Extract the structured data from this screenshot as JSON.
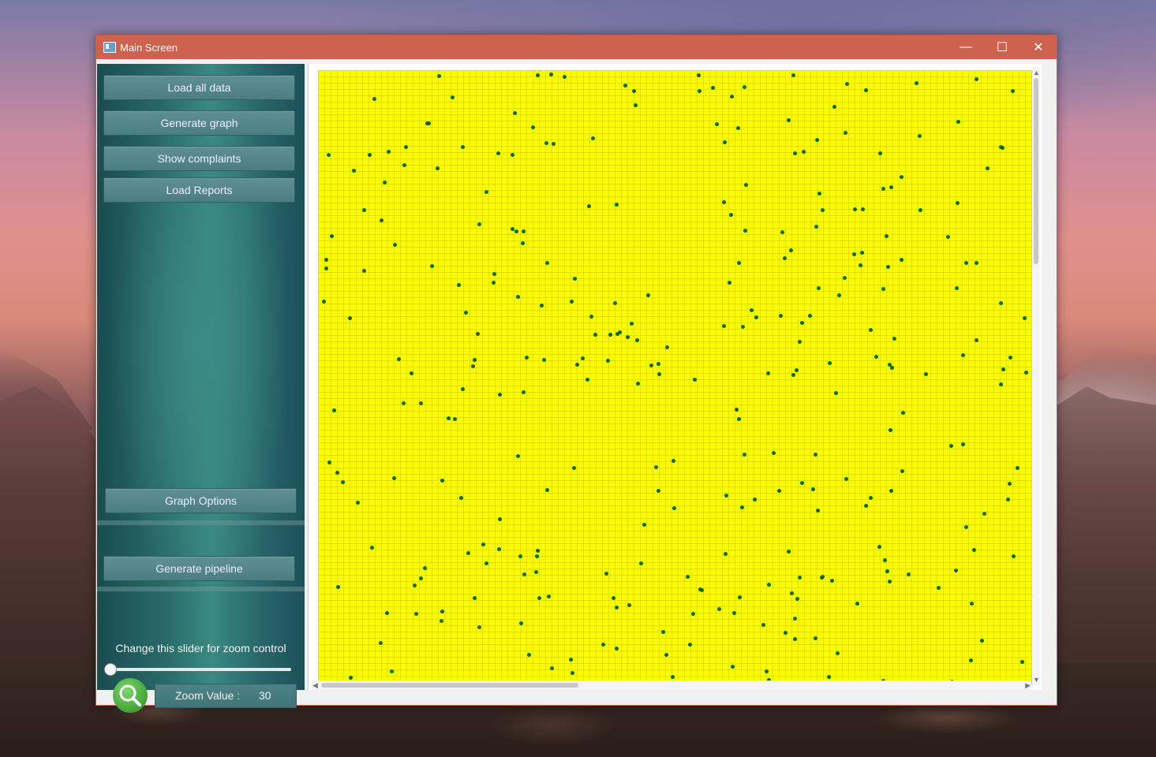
{
  "window": {
    "title": "Main Screen",
    "controls": {
      "minimize": "—",
      "maximize": "☐",
      "close": "✕"
    }
  },
  "left_panel": {
    "buttons": {
      "load_all_data": "Load all data",
      "generate_graph": "Generate graph",
      "show_complaints": "Show complaints",
      "load_reports": "Load Reports",
      "graph_options": "Graph Options",
      "generate_pipeline": "Generate pipeline"
    },
    "zoom": {
      "slider_caption": "Change this slider for zoom control",
      "slider_level": 0,
      "value_label": "Zoom Value :",
      "value": "30",
      "icon": "magnifier-icon"
    }
  },
  "graph": {
    "background_color": "#ffff00",
    "grid_color": "#c8c8c8",
    "node_color": "#0b6b0b"
  }
}
